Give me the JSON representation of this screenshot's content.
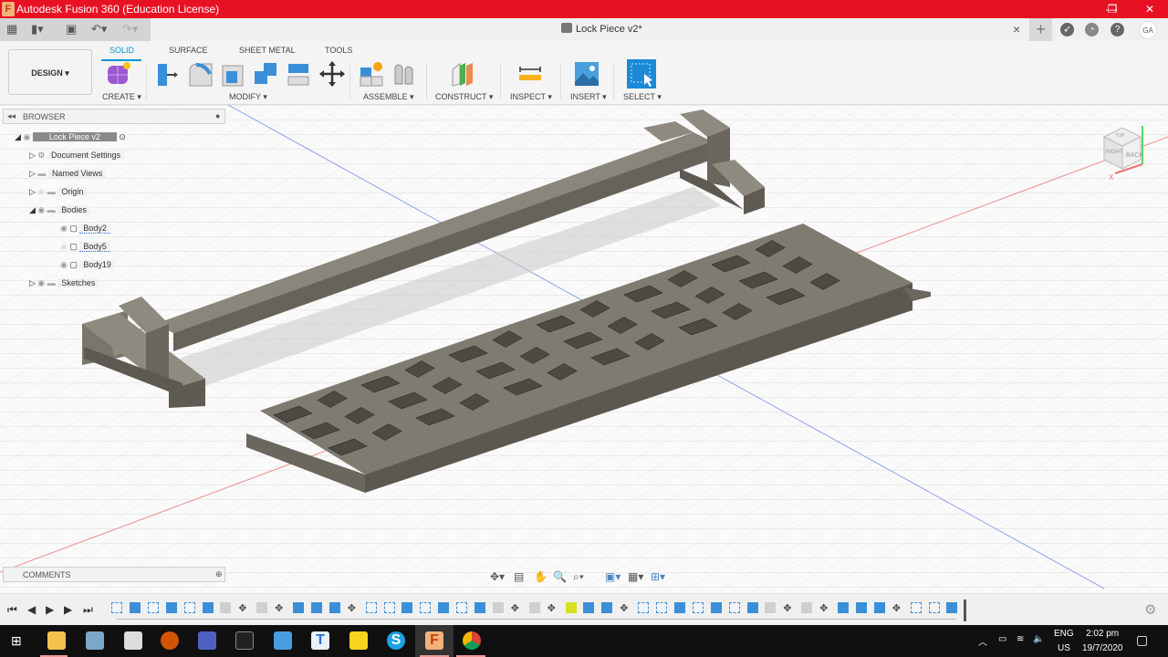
{
  "window": {
    "title": "Autodesk Fusion 360 (Education License)",
    "app_icon_letter": "F",
    "controls": [
      "minimize",
      "restore",
      "close"
    ]
  },
  "quick_access": {
    "items": [
      "apps-grid-icon",
      "file-icon",
      "save-icon",
      "undo-icon",
      "redo-icon"
    ]
  },
  "document_tab": {
    "title": "Lock Piece v2*",
    "close": "×",
    "new_tab": "+",
    "user_initials": "GA"
  },
  "ribbon": {
    "workspace": "DESIGN ▾",
    "tabs": [
      {
        "label": "SOLID",
        "active": true
      },
      {
        "label": "SURFACE"
      },
      {
        "label": "SHEET METAL"
      },
      {
        "label": "TOOLS"
      }
    ],
    "groups": [
      {
        "label": "CREATE ▾"
      },
      {
        "label": "MODIFY ▾"
      },
      {
        "label": "ASSEMBLE ▾"
      },
      {
        "label": "CONSTRUCT ▾"
      },
      {
        "label": "INSPECT ▾"
      },
      {
        "label": "INSERT ▾"
      },
      {
        "label": "SELECT ▾"
      }
    ]
  },
  "browser": {
    "title": "BROWSER",
    "root": "Lock Piece v2",
    "items": [
      {
        "label": "Document Settings",
        "icon": "gear-icon"
      },
      {
        "label": "Named Views",
        "icon": "folder-icon"
      },
      {
        "label": "Origin",
        "icon": "folder-icon",
        "hidden": true
      },
      {
        "label": "Bodies",
        "icon": "folder-icon",
        "expanded": true
      },
      {
        "label": "Body2",
        "icon": "body-icon",
        "child": true
      },
      {
        "label": "Body5",
        "icon": "body-icon",
        "child": true,
        "hidden": true
      },
      {
        "label": "Body19",
        "icon": "body-icon",
        "child": true
      },
      {
        "label": "Sketches",
        "icon": "folder-icon"
      }
    ]
  },
  "comments": {
    "title": "COMMENTS"
  },
  "viewcube": {
    "faces": [
      "TOP",
      "RIGHT",
      "BACK"
    ],
    "axis_x": "X"
  },
  "colors": {
    "title_bar": "#e81123",
    "accent": "#0696d7",
    "model": "#6e6a5f"
  },
  "timeline": {
    "feature_count": 47,
    "highlighted_index": 25
  },
  "taskbar": {
    "lang_top": "ENG",
    "lang_bottom": "US",
    "time": "2:02 pm",
    "date": "19/7/2020"
  }
}
